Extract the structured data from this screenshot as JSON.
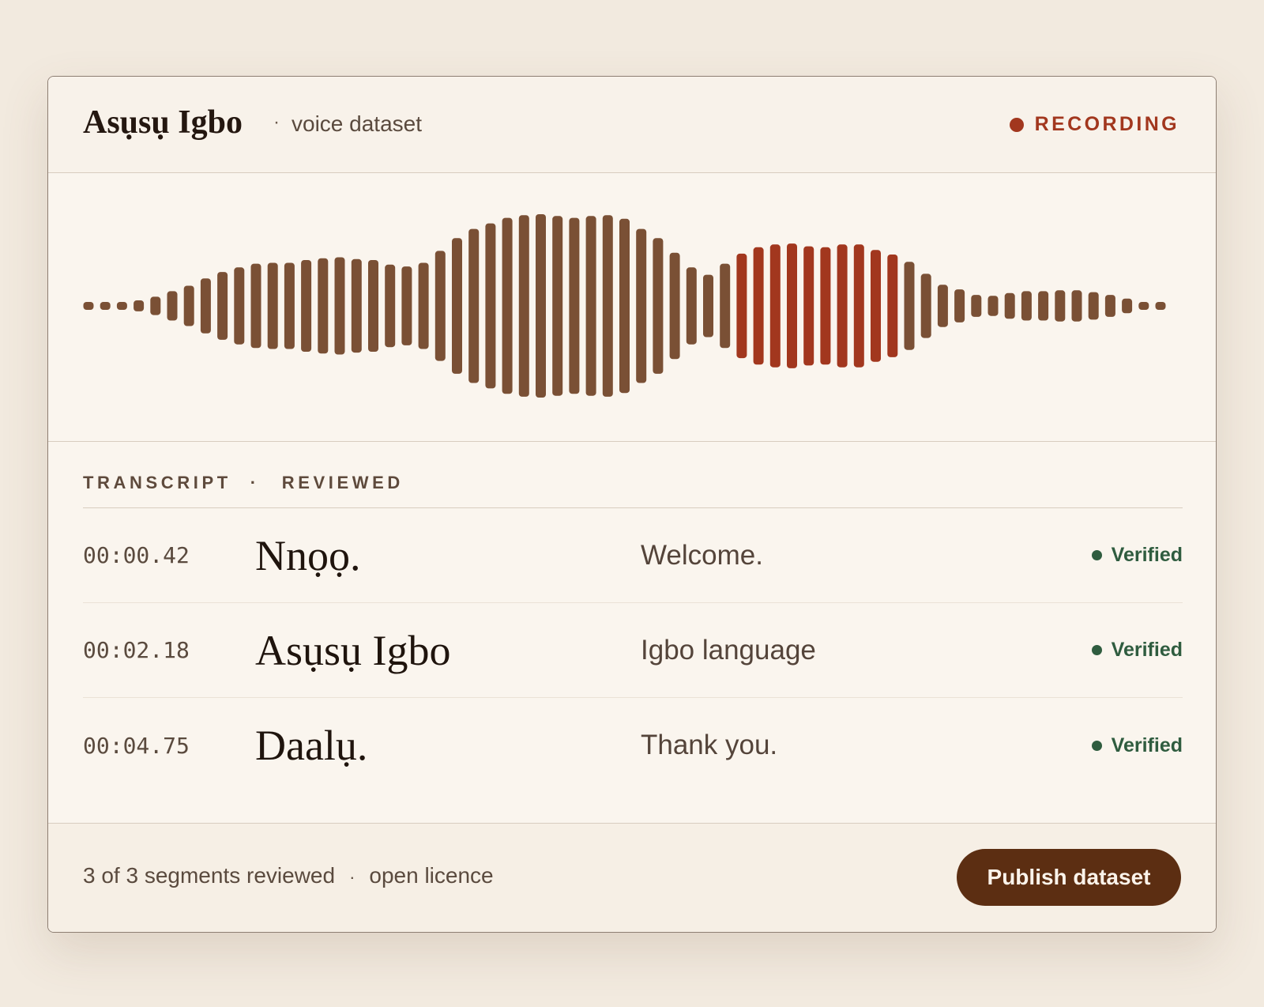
{
  "header": {
    "title": "Asụsụ Igbo",
    "separator": "·",
    "subtitle": "voice dataset",
    "status_label": "RECORDING",
    "status_color": "#a2371e"
  },
  "waveform": {
    "bar_color": "#7a5035",
    "highlight_color": "#a2371e",
    "amplitudes": [
      0.04,
      0.04,
      0.04,
      0.06,
      0.1,
      0.16,
      0.22,
      0.3,
      0.37,
      0.42,
      0.46,
      0.47,
      0.47,
      0.5,
      0.52,
      0.53,
      0.51,
      0.5,
      0.45,
      0.43,
      0.47,
      0.6,
      0.74,
      0.84,
      0.9,
      0.96,
      0.99,
      1.0,
      0.98,
      0.96,
      0.98,
      0.99,
      0.95,
      0.84,
      0.74,
      0.58,
      0.42,
      0.34,
      0.46,
      0.57,
      0.64,
      0.67,
      0.68,
      0.65,
      0.64,
      0.67,
      0.67,
      0.61,
      0.56,
      0.48,
      0.35,
      0.23,
      0.18,
      0.12,
      0.11,
      0.14,
      0.16,
      0.16,
      0.17,
      0.17,
      0.15,
      0.12,
      0.08,
      0.04,
      0.04
    ],
    "highlight_range": [
      39,
      48
    ]
  },
  "transcript": {
    "heading": "TRANSCRIPT",
    "separator": "·",
    "status": "REVIEWED",
    "rows": [
      {
        "time": "00:00.42",
        "igbo": "Nnọọ.",
        "english": "Welcome.",
        "status": "Verified"
      },
      {
        "time": "00:02.18",
        "igbo": "Asụsụ Igbo",
        "english": "Igbo language",
        "status": "Verified"
      },
      {
        "time": "00:04.75",
        "igbo": "Daalụ.",
        "english": "Thank you.",
        "status": "Verified"
      }
    ],
    "verified_color": "#2f5c3f"
  },
  "footer": {
    "summary": "3 of 3 segments reviewed",
    "separator": "·",
    "licence": "open licence",
    "publish_label": "Publish dataset",
    "button_color": "#5c2e12"
  }
}
